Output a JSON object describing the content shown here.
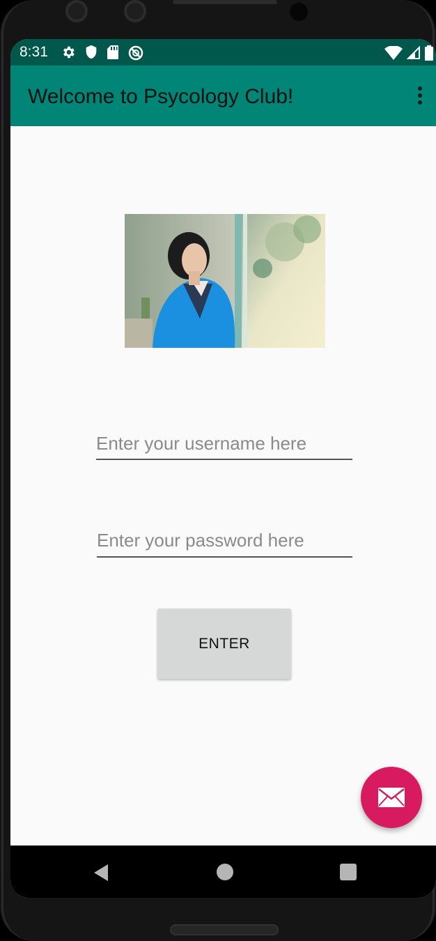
{
  "status_bar": {
    "time": "8:31",
    "left_icons": [
      "gear-icon",
      "shield-icon",
      "sd-card-icon",
      "no-disturb-icon"
    ],
    "right_icons": [
      "wifi-icon",
      "cell-signal-icon",
      "battery-icon"
    ],
    "bg_color": "#00574b"
  },
  "app_bar": {
    "title": "Welcome to Psycology Club!",
    "bg_color": "#008577"
  },
  "login_form": {
    "username_placeholder": "Enter your username here",
    "username_value": "",
    "password_placeholder": "Enter your password here",
    "password_value": "",
    "enter_label": "ENTER"
  },
  "fab": {
    "icon": "mail-icon",
    "color": "#d81b60"
  },
  "nav_bar": {
    "buttons": [
      "back-icon",
      "home-icon",
      "recents-icon"
    ]
  }
}
